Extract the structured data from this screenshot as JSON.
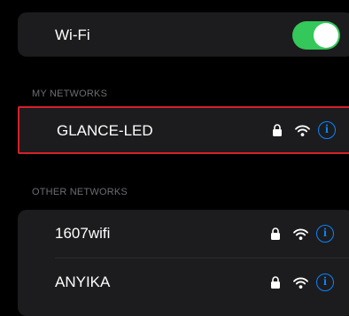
{
  "wifi": {
    "label": "Wi-Fi",
    "enabled": true
  },
  "my_networks": {
    "header": "MY NETWORKS",
    "items": [
      {
        "name": "GLANCE-LED",
        "secured": true
      }
    ]
  },
  "other_networks": {
    "header": "OTHER NETWORKS",
    "items": [
      {
        "name": "1607wifi",
        "secured": true
      },
      {
        "name": "ANYIKA",
        "secured": true
      }
    ]
  },
  "icons": {
    "lock": "lock-icon",
    "wifi": "wifi-signal-icon",
    "info": "info-icon",
    "info_glyph": "i"
  },
  "colors": {
    "toggle_on": "#34c759",
    "info_blue": "#0a84ff",
    "highlight_red": "#d6202a"
  }
}
